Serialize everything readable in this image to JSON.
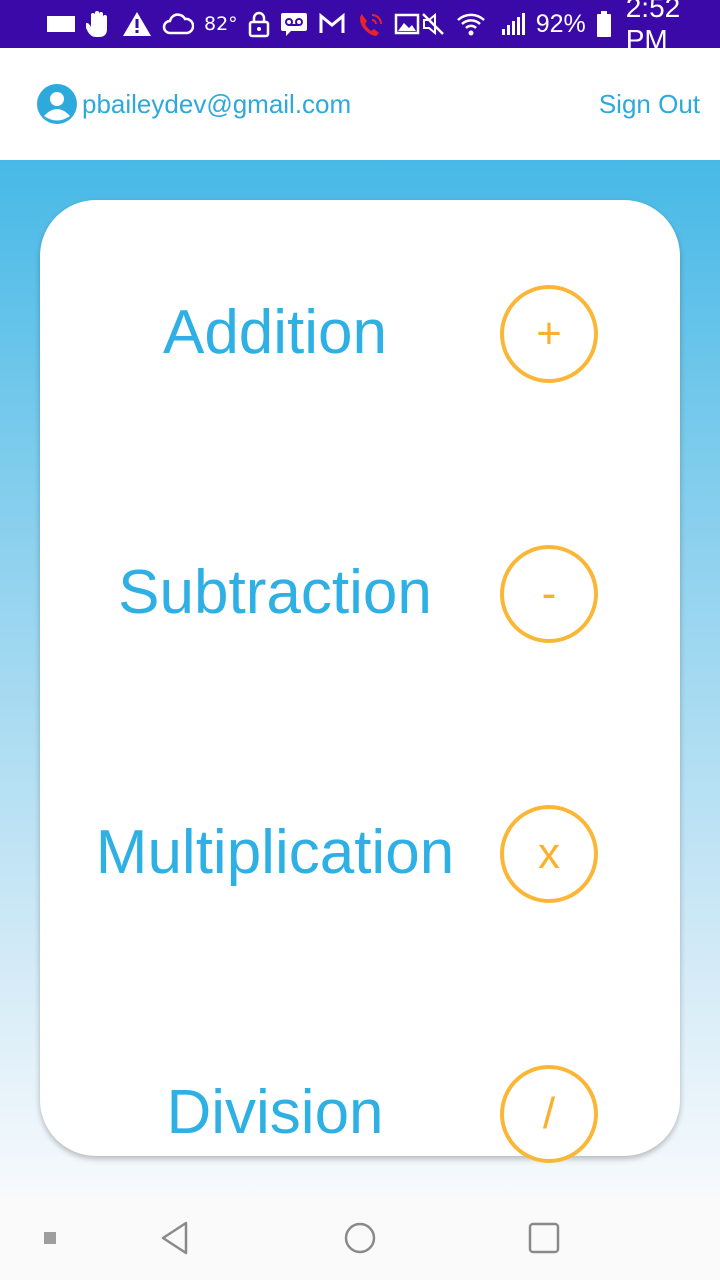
{
  "status_bar": {
    "temperature": "82°",
    "battery_percent": "92%",
    "time": "2:52 PM",
    "icons": [
      "notification-square-icon",
      "hand-icon",
      "warning-icon",
      "cloud-icon",
      "lock-icon",
      "voicemail-icon",
      "gmail-icon",
      "wifi-calling-icon",
      "image-icon",
      "mute-icon",
      "wifi-icon",
      "signal-icon",
      "battery-icon"
    ]
  },
  "header": {
    "user_email": "pbaileydev@gmail.com",
    "sign_out_label": "Sign Out"
  },
  "operations": [
    {
      "label": "Addition",
      "symbol": "+"
    },
    {
      "label": "Subtraction",
      "symbol": "-"
    },
    {
      "label": "Multiplication",
      "symbol": "x"
    },
    {
      "label": "Division",
      "symbol": "/"
    }
  ],
  "nav_bar": {
    "icons": [
      "recent-dot-icon",
      "back-icon",
      "home-icon",
      "overview-icon"
    ]
  },
  "colors": {
    "status_bar": "#3c09a9",
    "accent_blue": "#2eb0e4",
    "accent_orange": "#fbb636"
  }
}
